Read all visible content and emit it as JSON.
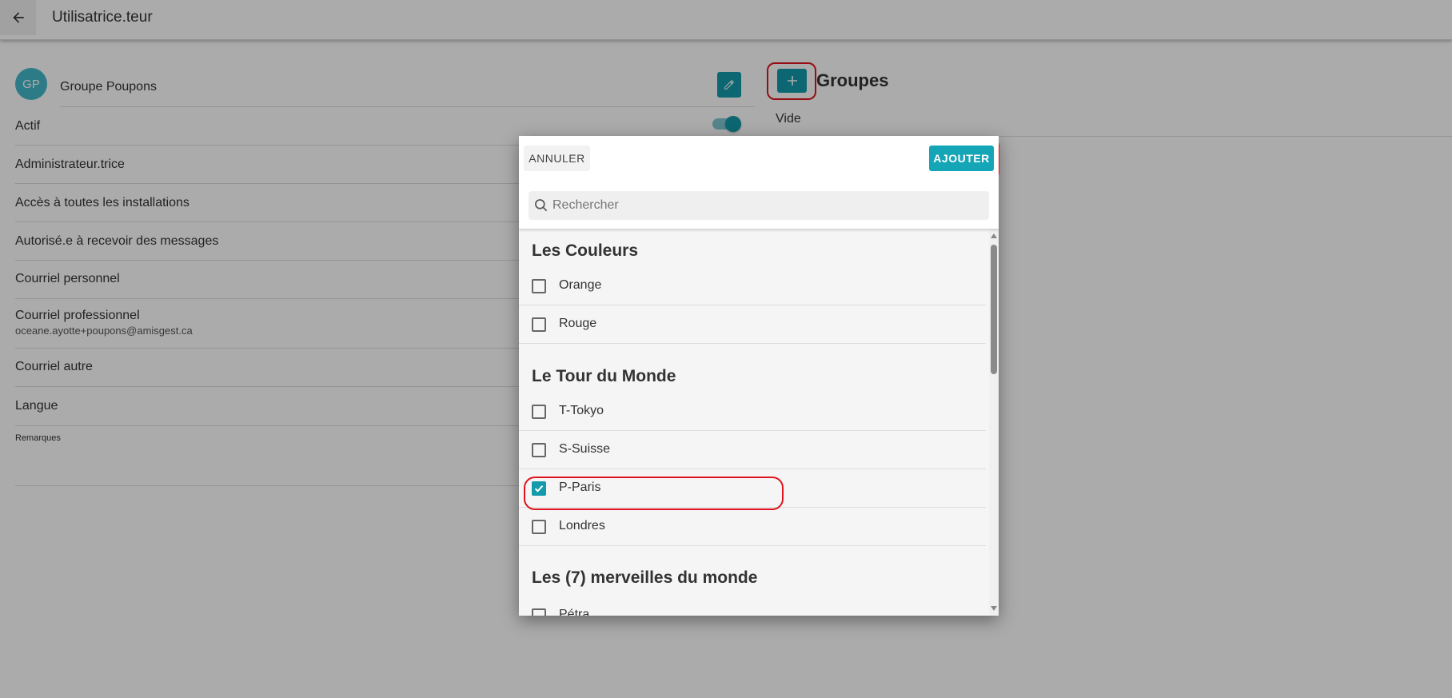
{
  "app": {
    "title": "Utilisatrice.teur"
  },
  "profile": {
    "avatar_initials": "GP",
    "name": "Groupe Poupons",
    "fields": [
      {
        "label": "Actif"
      },
      {
        "label": "Administrateur.trice"
      },
      {
        "label": "Accès à toutes les installations"
      },
      {
        "label": "Autorisé.e à recevoir des messages"
      },
      {
        "label": "Courriel personnel"
      },
      {
        "label": "Courriel professionnel",
        "value": "oceane.ayotte+poupons@amisgest.ca"
      },
      {
        "label": "Courriel autre"
      },
      {
        "label": "Langue"
      },
      {
        "label": "Remarques"
      }
    ],
    "active": true
  },
  "groups": {
    "title": "Groupes",
    "empty_label": "Vide"
  },
  "modal": {
    "cancel_label": "ANNULER",
    "add_label": "AJOUTER",
    "search_placeholder": "Rechercher",
    "sections": [
      {
        "title": "Les Couleurs",
        "items": [
          {
            "label": "Orange",
            "checked": false
          },
          {
            "label": "Rouge",
            "checked": false
          }
        ]
      },
      {
        "title": "Le Tour du Monde",
        "items": [
          {
            "label": "T-Tokyo",
            "checked": false
          },
          {
            "label": "S-Suisse",
            "checked": false
          },
          {
            "label": "P-Paris",
            "checked": true
          },
          {
            "label": "Londres",
            "checked": false
          }
        ]
      },
      {
        "title": "Les (7) merveilles du monde",
        "items": [
          {
            "label": "Pétra",
            "checked": false
          }
        ]
      }
    ]
  },
  "colors": {
    "accent": "#139aab",
    "annotation": "#e0141e"
  },
  "icons": {
    "back": "arrow-left-icon",
    "edit": "pencil-icon",
    "add": "plus-icon",
    "search": "search-icon"
  }
}
